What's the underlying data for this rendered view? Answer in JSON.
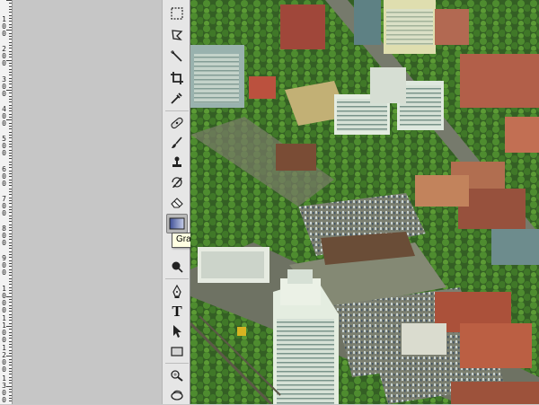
{
  "ruler": {
    "labels": [
      "1\n0\n0",
      "2\n0\n0",
      "3\n0\n0",
      "4\n0\n0",
      "5\n0\n0",
      "6\n0\n0",
      "7\n0\n0",
      "8\n0\n0",
      "9\n0\n0",
      "1\n0\n0\n0",
      "1\n1\n0\n0",
      "1\n2\n0\n0",
      "1\n3\n0\n0"
    ]
  },
  "tools": [
    {
      "name": "rectangular-marquee-tool",
      "icon": "marquee-icon"
    },
    {
      "name": "lasso-tool",
      "icon": "lasso-icon"
    },
    {
      "name": "magic-wand-tool",
      "icon": "magic-wand-icon"
    },
    {
      "name": "crop-tool",
      "icon": "crop-icon"
    },
    {
      "name": "eyedropper-tool",
      "icon": "eyedropper-icon"
    },
    {
      "name": "healing-brush-tool",
      "icon": "bandage-icon"
    },
    {
      "name": "brush-tool",
      "icon": "brush-icon"
    },
    {
      "name": "clone-stamp-tool",
      "icon": "stamp-icon"
    },
    {
      "name": "history-brush-tool",
      "icon": "history-brush-icon"
    },
    {
      "name": "eraser-tool",
      "icon": "eraser-icon"
    },
    {
      "name": "gradient-tool",
      "icon": "gradient-icon",
      "selected": true
    },
    {
      "name": "dodge-tool",
      "icon": "dodge-icon"
    },
    {
      "name": "pen-tool",
      "icon": "pen-icon"
    },
    {
      "name": "type-tool",
      "icon": "type-icon",
      "glyph": "T"
    },
    {
      "name": "path-selection-tool",
      "icon": "arrow-icon"
    },
    {
      "name": "rectangle-shape-tool",
      "icon": "rectangle-icon"
    },
    {
      "name": "notes-tool",
      "icon": "notes-icon"
    },
    {
      "name": "zoom-tool",
      "icon": "zoom-icon"
    }
  ],
  "tooltip": {
    "text": "Gradient Tool (G)"
  },
  "colors": {
    "accent": "#5a6fb0",
    "tooltip_bg": "#ffffe1",
    "panel": "#e6e6e6"
  }
}
